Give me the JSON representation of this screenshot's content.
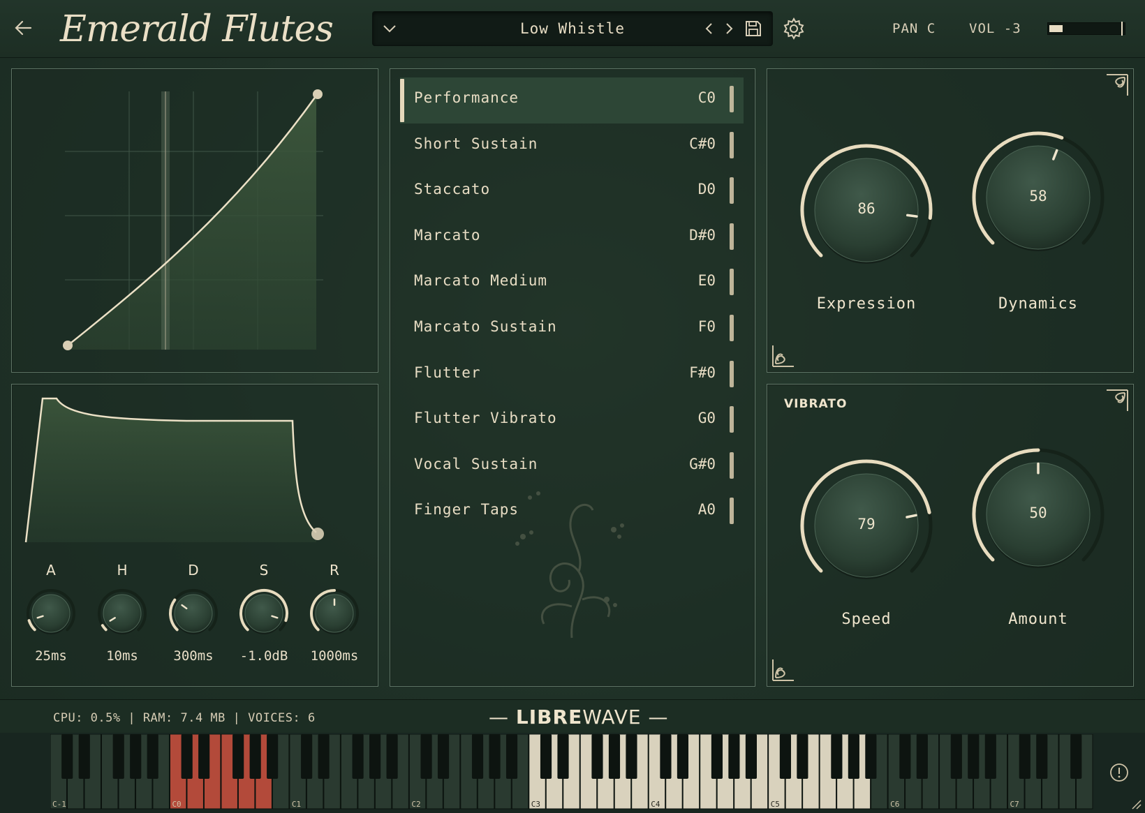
{
  "header": {
    "app_title": "Emerald Flutes",
    "preset_name": "Low Whistle",
    "pan_label": "PAN C",
    "vol_label": "VOL -3",
    "volume_meter_level": 0.18,
    "icons": [
      "back-arrow-icon",
      "chevron-down-icon",
      "chevron-left-icon",
      "chevron-right-icon",
      "save-icon",
      "gear-icon"
    ]
  },
  "envelope": {
    "controls": [
      {
        "letter": "A",
        "value": "25ms",
        "knob_level": 0.1
      },
      {
        "letter": "H",
        "value": "10ms",
        "knob_level": 0.05
      },
      {
        "letter": "D",
        "value": "300ms",
        "knob_level": 0.3
      },
      {
        "letter": "S",
        "value": "-1.0dB",
        "knob_level": 0.9
      },
      {
        "letter": "R",
        "value": "1000ms",
        "knob_level": 0.5
      }
    ]
  },
  "articulations": [
    {
      "name": "Performance",
      "key": "C0",
      "active": true
    },
    {
      "name": "Short Sustain",
      "key": "C#0",
      "active": false
    },
    {
      "name": "Staccato",
      "key": "D0",
      "active": false
    },
    {
      "name": "Marcato",
      "key": "D#0",
      "active": false
    },
    {
      "name": "Marcato Medium",
      "key": "E0",
      "active": false
    },
    {
      "name": "Marcato Sustain",
      "key": "F0",
      "active": false
    },
    {
      "name": "Flutter",
      "key": "F#0",
      "active": false
    },
    {
      "name": "Flutter Vibrato",
      "key": "G0",
      "active": false
    },
    {
      "name": "Vocal Sustain",
      "key": "G#0",
      "active": false
    },
    {
      "name": "Finger Taps",
      "key": "A0",
      "active": false
    }
  ],
  "main_knobs": {
    "expression": {
      "label": "Expression",
      "value": "86",
      "level": 0.86
    },
    "dynamics": {
      "label": "Dynamics",
      "value": "58",
      "level": 0.58
    }
  },
  "vibrato": {
    "title": "VIBRATO",
    "speed": {
      "label": "Speed",
      "value": "79",
      "level": 0.79
    },
    "amount": {
      "label": "Amount",
      "value": "50",
      "level": 0.5
    }
  },
  "footer": {
    "status": "CPU: 0.5% | RAM: 7.4 MB | VOICES: 6",
    "brand_bold": "LIBRE",
    "brand_light": "WAVE"
  },
  "keyboard": {
    "octave_labels": [
      "C-1",
      "C0",
      "C1",
      "C2",
      "C3",
      "C4",
      "C5",
      "C6",
      "C7"
    ],
    "keyswitch_range": "C0–A0",
    "playable_range": "C3–A5",
    "colors": {
      "keyswitch": "#b34a3a",
      "playable": "#d9d2bd",
      "inactive_white": "#2a3a30",
      "black": "#0d1410"
    }
  },
  "colors": {
    "accent": "#e8dcbf",
    "panel_bg": "#1f3127",
    "panel_border": "#5f7566"
  }
}
